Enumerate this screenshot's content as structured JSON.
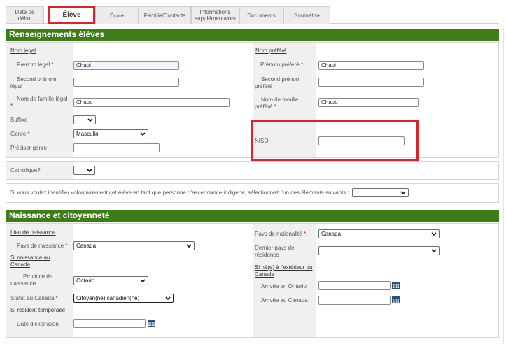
{
  "tabs": [
    {
      "label": "Date de début"
    },
    {
      "label": "Élève"
    },
    {
      "label": "École"
    },
    {
      "label": "Famille/Contacts"
    },
    {
      "label": "Informations supplémentaires"
    },
    {
      "label": "Documents"
    },
    {
      "label": "Soumettre"
    }
  ],
  "colors": {
    "accent": "#3e7c17",
    "highlight": "#e0202a",
    "required": "#d01020"
  },
  "section1": {
    "title": "Renseignements élèves",
    "legal_header": "Nom légal",
    "preferred_header": "Nom préféré",
    "legal_first_label": "Prénom légal",
    "legal_first_value": "Chapi",
    "legal_middle_label": "Second prénom légal",
    "legal_middle_value": "",
    "legal_last_label": "Nom de famille légal",
    "legal_last_value": "Chapo",
    "pref_first_label": "Prénom préféré",
    "pref_first_value": "Chapi",
    "pref_middle_label": "Second prénom préféré",
    "pref_middle_value": "",
    "pref_last_label": "Nom de famille préféré",
    "pref_last_value": "Chapo",
    "suffix_label": "Suffixe",
    "suffix_value": "",
    "gender_label": "Genre",
    "gender_value": "Masculin",
    "gender_specify_label": "Préciser genre",
    "gender_specify_value": "",
    "oen_label": "NISO",
    "oen_value": "",
    "catholic_label": "Catholique?",
    "catholic_value": "",
    "indigenous_text": "Si vous voulez identifier volontairement cet élève en tant que personne d'ascendance indigène, sélectionnez l'un des éléments suivants :",
    "indigenous_value": "",
    "required_marker": "*"
  },
  "section2": {
    "title": "Naissance et citoyenneté",
    "birthplace_header": "Lieu de naissance",
    "birth_country_label": "Pays de naissance",
    "birth_country_value": "Canada",
    "if_born_canada_header": "Si naissance au Canada",
    "birth_province_label": "Province de naissance",
    "birth_province_value": "Ontario",
    "status_label": "Statut au Canada",
    "status_value": "Citoyen(ne) canadien(ne)",
    "temp_resident_header": "Si résident temporaire",
    "expiry_label": "Date d'expiration",
    "expiry_value": "",
    "nationality_label": "Pays de nationalité",
    "nationality_value": "Canada",
    "last_country_label": "Dernier pays de résidence",
    "last_country_value": "",
    "born_outside_header": "Si né(e) à l'extérieur du Canada",
    "arrival_ontario_label": "Arrivée en Ontario",
    "arrival_ontario_value": "",
    "arrival_canada_label": "Arrivée au Canada",
    "arrival_canada_value": ""
  }
}
